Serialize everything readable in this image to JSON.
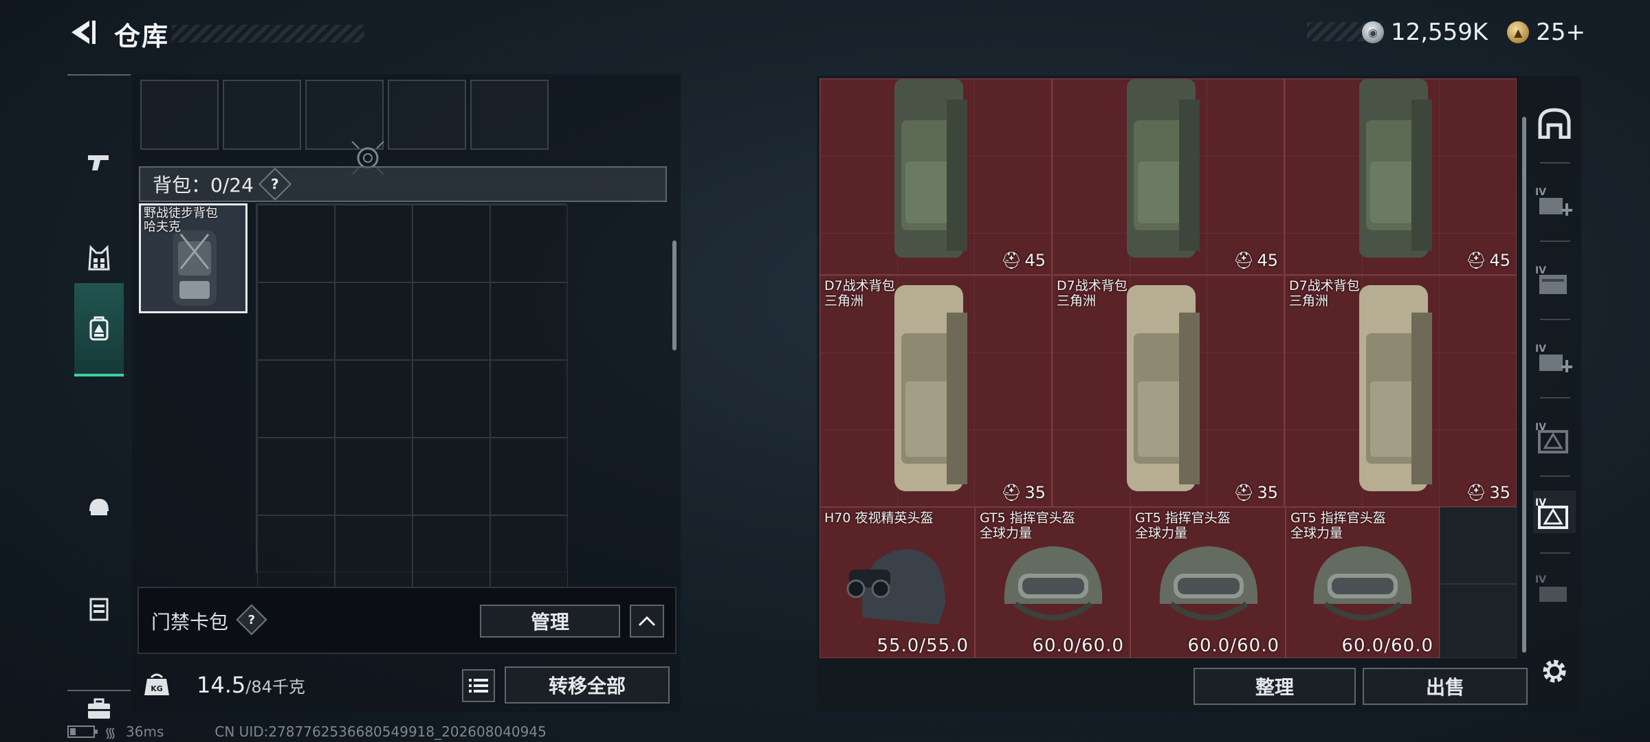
{
  "header": {
    "title": "仓库",
    "currency": {
      "silver": "12,559K",
      "gold": "25+"
    }
  },
  "left_nav": {
    "items": [
      {
        "name": "weapons",
        "icon": "pistol-icon",
        "active": false
      },
      {
        "name": "armor",
        "icon": "vest-icon",
        "active": false
      },
      {
        "name": "backpack",
        "icon": "backpack-icon",
        "active": true
      },
      {
        "name": "helmet",
        "icon": "helmet-icon",
        "active": false
      },
      {
        "name": "chest-rig",
        "icon": "chest-rig-icon",
        "active": false
      },
      {
        "name": "toolbox",
        "icon": "toolbox-icon",
        "active": false
      }
    ]
  },
  "backpack_section": {
    "label": "背包：0/24",
    "help": "?",
    "equipped_item_name_line1": "野战徒步背包",
    "equipped_item_name_line2": "哈夫克"
  },
  "card_pack": {
    "label": "门禁卡包",
    "help": "?",
    "manage_label": "管理"
  },
  "weight": {
    "value": "14.5",
    "max": "/84千克",
    "icon_label": "KG"
  },
  "actions": {
    "transfer_all_label": "转移全部",
    "sort_label": "整理",
    "sell_label": "出售"
  },
  "storage": {
    "rows": [
      [
        {
          "name1": "",
          "name2": "",
          "badge": "45",
          "type": "backpack-green"
        },
        {
          "name1": "",
          "name2": "",
          "badge": "45",
          "type": "backpack-green"
        },
        {
          "name1": "",
          "name2": "",
          "badge": "45",
          "type": "backpack-green"
        }
      ],
      [
        {
          "name1": "D7战术背包",
          "name2": "三角洲",
          "badge": "35",
          "type": "backpack-tan"
        },
        {
          "name1": "D7战术背包",
          "name2": "三角洲",
          "badge": "35",
          "type": "backpack-tan"
        },
        {
          "name1": "D7战术背包",
          "name2": "三角洲",
          "badge": "35",
          "type": "backpack-tan"
        }
      ],
      [
        {
          "name1": "H70 夜视精英头盔",
          "name2": "",
          "durability": "55.0/55.0",
          "type": "helmet-nv"
        },
        {
          "name1": "GT5 指挥官头盔",
          "name2": "全球力量",
          "durability": "60.0/60.0",
          "type": "helmet"
        },
        {
          "name1": "GT5 指挥官头盔",
          "name2": "全球力量",
          "durability": "60.0/60.0",
          "type": "helmet"
        },
        {
          "name1": "GT5 指挥官头盔",
          "name2": "全球力量",
          "durability": "60.0/60.0",
          "type": "helmet"
        }
      ]
    ]
  },
  "right_tools": [
    {
      "icon": "dome-icon",
      "roman": ""
    },
    {
      "icon": "add-case-icon",
      "roman": "IV"
    },
    {
      "icon": "folder-icon",
      "roman": "IV"
    },
    {
      "icon": "add-case-icon",
      "roman": "IV"
    },
    {
      "icon": "triangle-case-icon",
      "roman": "IV"
    },
    {
      "icon": "triangle-case-icon",
      "roman": "IV"
    },
    {
      "icon": "case-icon",
      "roman": "IV"
    },
    {
      "icon": "gear-icon",
      "roman": ""
    }
  ],
  "status": {
    "ping": "36ms",
    "uid": "CN UID:2787762536680549918_202608040945"
  },
  "colors": {
    "slot_red": "#5a2328",
    "active_nav": "#3fcf9e"
  }
}
